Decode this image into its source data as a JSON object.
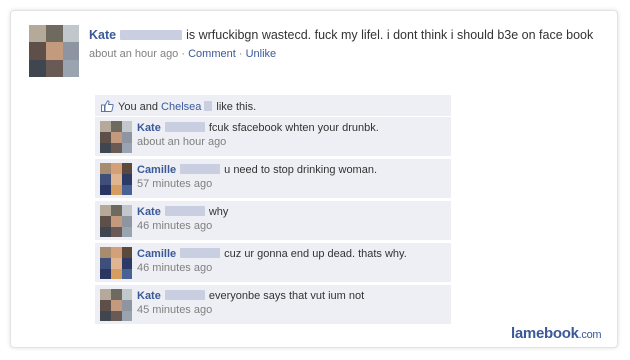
{
  "story": {
    "author": "Kate",
    "text": "is wrfuckibgn wastecd. fuck my lifel. i dont think i should b3e on face book",
    "time": "about an hour ago",
    "sep": "·",
    "comment_label": "Comment",
    "unlike_label": "Unlike"
  },
  "likes": {
    "you_and": "You and",
    "other": "Chelsea",
    "suffix": "like this."
  },
  "comments": [
    {
      "author": "Kate",
      "text": "fcuk sfacebook whten your drunbk.",
      "time": "about an hour ago"
    },
    {
      "author": "Camille",
      "text": "u need to stop drinking woman.",
      "time": "57 minutes ago"
    },
    {
      "author": "Kate",
      "text": "why",
      "time": "46 minutes ago"
    },
    {
      "author": "Camille",
      "text": "cuz ur gonna end up dead. thats why.",
      "time": "46 minutes ago"
    },
    {
      "author": "Kate",
      "text": "everyonbe says that vut ium not",
      "time": "45 minutes ago"
    }
  ],
  "brand": {
    "name": "lamebook",
    "tld": ".com"
  },
  "colors": {
    "link": "#3b5998",
    "comment_bg": "#edeff4",
    "meta_gray": "#808080"
  }
}
